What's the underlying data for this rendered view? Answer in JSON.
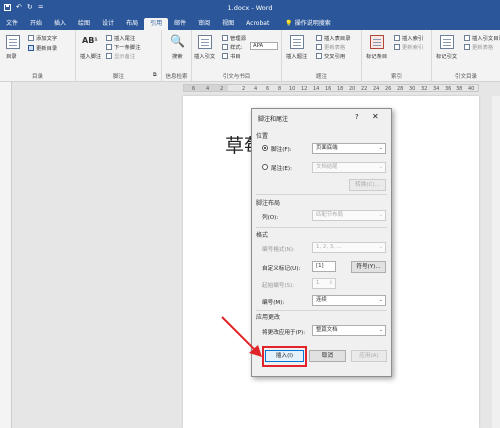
{
  "titlebar": {
    "title": "1.docx - Word",
    "save_icon": "save-icon",
    "undo_icon": "undo-icon",
    "redo_icon": "redo-icon",
    "customize": "="
  },
  "tabs": [
    "文件",
    "开始",
    "插入",
    "绘图",
    "设计",
    "布局",
    "引用",
    "邮件",
    "审阅",
    "视图",
    "Acrobat"
  ],
  "active_tab": "引用",
  "tell_me": "操作说明搜索",
  "ribbon": {
    "toc": {
      "big": "目录",
      "add_text": "添加文字",
      "update": "更新目录",
      "group": "目录"
    },
    "footnotes": {
      "insert_footnote": "插入脚注",
      "insert_endnote": "插入尾注",
      "ab": "AB¹",
      "next": "下一条脚注",
      "show": "显示备注",
      "group": "脚注",
      "expander": "⧉"
    },
    "research": {
      "big": "搜索",
      "group": "信息检索"
    },
    "citations": {
      "insert": "插入引文",
      "manage": "管理源",
      "style_label": "样式:",
      "style": "APA",
      "biblio": "书目",
      "group": "引文与书目"
    },
    "captions": {
      "insert": "插入题注",
      "table_of_figures": "插入表目录",
      "update_table": "更新表格",
      "cross_ref": "交叉引用",
      "group": "题注"
    },
    "index": {
      "mark": "标记条目",
      "insert": "插入索引",
      "update": "更新索引",
      "group": "索引"
    },
    "toa": {
      "mark": "标记引文",
      "insert": "插入引文目录",
      "update": "更新表格",
      "group": "引文目录"
    }
  },
  "ruler": {
    "left_numbers": [
      "6",
      "4",
      "2"
    ],
    "numbers": [
      "2",
      "4",
      "6",
      "8",
      "10",
      "12",
      "14",
      "16",
      "18",
      "20",
      "22",
      "24",
      "26",
      "28",
      "30",
      "32",
      "34",
      "36",
      "38",
      "40",
      "42"
    ]
  },
  "document": {
    "title_fragment": "草莓"
  },
  "dialog": {
    "title": "脚注和尾注",
    "help": "?",
    "close": "✕",
    "location": {
      "heading": "位置",
      "footnote_label": "脚注(F):",
      "footnote_value": "页面底端",
      "footnote_selected": true,
      "endnote_label": "尾注(E):",
      "endnote_value": "文档结尾",
      "convert_button": "转换(C)..."
    },
    "layout": {
      "heading": "脚注布局",
      "columns_label": "列(O):",
      "columns_value": "匹配节布局"
    },
    "format": {
      "heading": "格式",
      "number_format_label": "编号格式(N):",
      "number_format_value": "1, 2, 3, ...",
      "custom_mark_label": "自定义标记(U):",
      "custom_mark_value": "[1]",
      "symbol_button": "符号(Y)...",
      "start_at_label": "起始编号(S):",
      "start_at_value": "1",
      "numbering_label": "编号(M):",
      "numbering_value": "连续"
    },
    "apply": {
      "heading": "应用更改",
      "apply_to_label": "将更改应用于(P):",
      "apply_to_value": "整篇文档"
    },
    "buttons": {
      "insert": "插入(I)",
      "cancel": "取消",
      "apply": "应用(A)"
    }
  },
  "colors": {
    "word_blue": "#2b579a",
    "highlight_red": "#e0242a"
  }
}
